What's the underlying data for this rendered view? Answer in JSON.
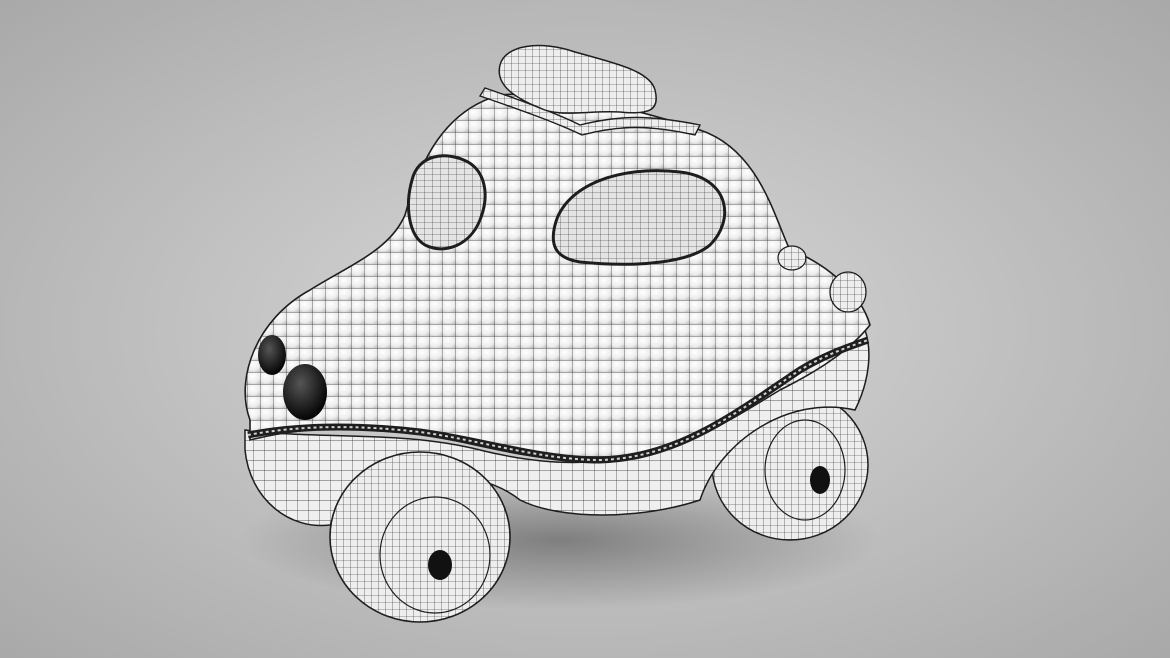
{
  "scene": {
    "subject": "toy-car-wireframe",
    "colors": {
      "background_center": "#d8d8d8",
      "background_edge": "#a9a9a9",
      "body_fill": "#f4f4f4",
      "wire": "#1e1e1e",
      "tire_fill": "#ececec",
      "headlight": "#0d0d0d",
      "window_fill": "#e6e6e6"
    }
  }
}
